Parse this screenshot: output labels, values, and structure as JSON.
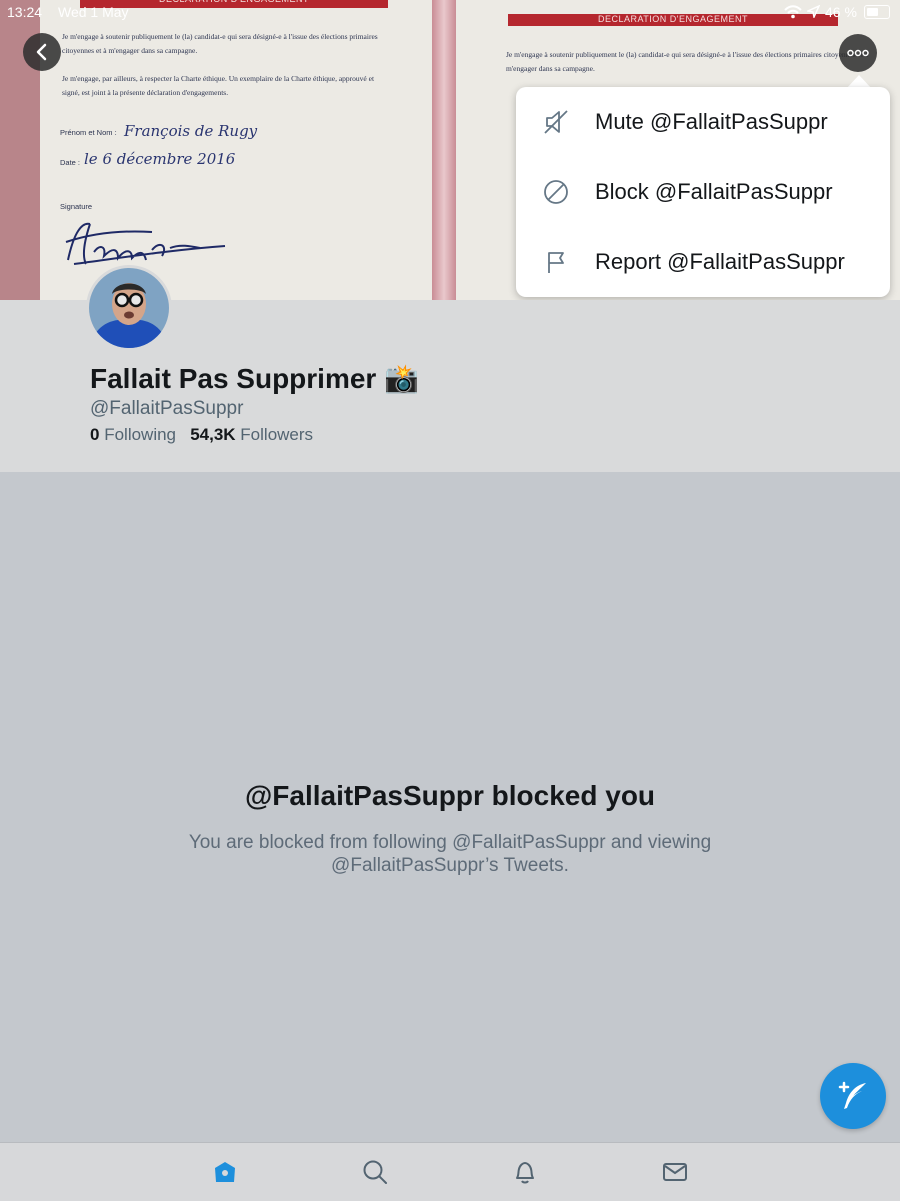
{
  "status_bar": {
    "time": "13:24",
    "date": "Wed 1 May",
    "battery": "46 %"
  },
  "banner": {
    "left_doc": {
      "header": "DÉCLARATION D'ENGAGEMENT",
      "para1": "Je m'engage à soutenir publiquement le (la) candidat-e qui sera désigné-e à l'issue des élections primaires citoyennes et à m'engager dans sa campagne.",
      "para2": "Je m'engage, par ailleurs, à respecter la Charte éthique. Un exemplaire de la Charte éthique, approuvé et signé, est joint à la présente déclaration d'engagements.",
      "name_label": "Prénom et Nom :",
      "name_value": "François de Rugy",
      "date_label": "Date :",
      "date_value": "le 6 décembre 2016",
      "signature_label": "Signature"
    },
    "right_doc": {
      "header": "DECLARATION D'ENGAGEMENT",
      "para1": "Je m'engage à soutenir publiquement le (la) candidat-e qui sera désigné-e à l'issue des élections primaires citoyennes et à m'engager dans sa campagne."
    }
  },
  "menu": {
    "items": [
      {
        "label": "Mute @FallaitPasSuppr",
        "icon": "mute-icon"
      },
      {
        "label": "Block @FallaitPasSuppr",
        "icon": "block-icon"
      },
      {
        "label": "Report @FallaitPasSuppr",
        "icon": "flag-icon"
      }
    ]
  },
  "profile": {
    "name": "Fallait Pas Supprimer 📸",
    "handle": "@FallaitPasSuppr",
    "following_count": "0",
    "following_label": "Following",
    "followers_count": "54,3K",
    "followers_label": "Followers"
  },
  "blocked": {
    "title": "@FallaitPasSuppr blocked you",
    "description": "You are blocked from following @FallaitPasSuppr and viewing @FallaitPasSuppr’s Tweets."
  },
  "colors": {
    "accent": "#1d8fdc",
    "doc_header": "#b5272e",
    "menu_bg": "#ffffff"
  },
  "tabbar": {
    "items": [
      "home-icon",
      "search-icon",
      "notifications-icon",
      "messages-icon"
    ]
  }
}
